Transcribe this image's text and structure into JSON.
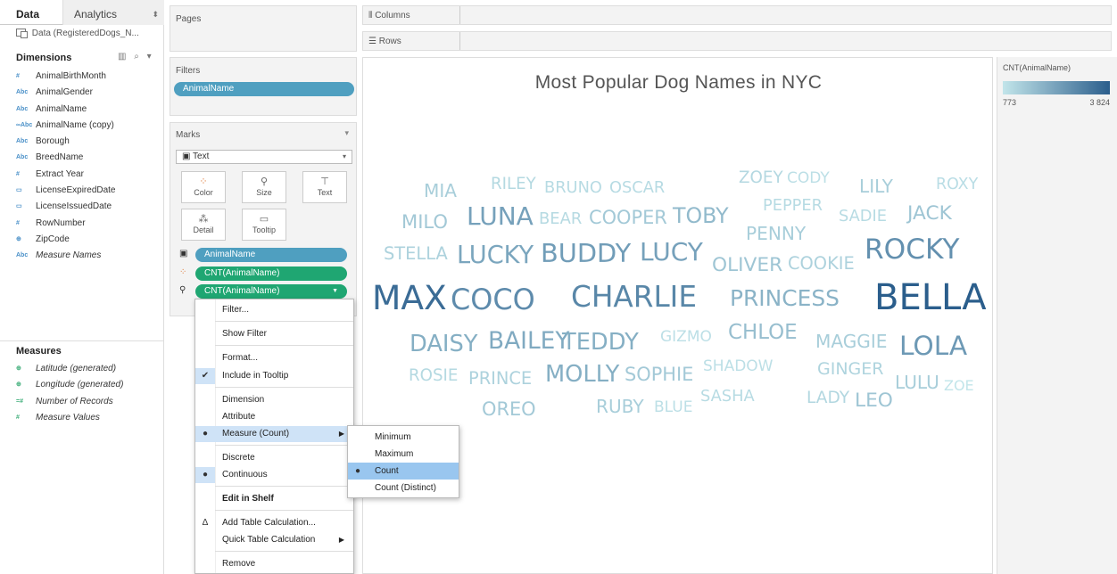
{
  "tabs": {
    "data": "Data",
    "analytics": "Analytics"
  },
  "datasource": "Data (RegisteredDogs_N...",
  "dimensions": {
    "header": "Dimensions",
    "tools": "▥ ⌕ ▾",
    "fields": [
      {
        "icon": "#",
        "label": "AnimalBirthMonth",
        "kind": "dim"
      },
      {
        "icon": "Abc",
        "label": "AnimalGender",
        "kind": "dim"
      },
      {
        "icon": "Abc",
        "label": "AnimalName",
        "kind": "dim"
      },
      {
        "icon": "∞Abc",
        "label": "AnimalName (copy)",
        "kind": "dim"
      },
      {
        "icon": "Abc",
        "label": "Borough",
        "kind": "dim"
      },
      {
        "icon": "Abc",
        "label": "BreedName",
        "kind": "dim"
      },
      {
        "icon": "#",
        "label": "Extract Year",
        "kind": "dim"
      },
      {
        "icon": "▭",
        "label": "LicenseExpiredDate",
        "kind": "dim"
      },
      {
        "icon": "▭",
        "label": "LicenseIssuedDate",
        "kind": "dim"
      },
      {
        "icon": "#",
        "label": "RowNumber",
        "kind": "dim"
      },
      {
        "icon": "⊕",
        "label": "ZipCode",
        "kind": "dim"
      },
      {
        "icon": "Abc",
        "label": "Measure Names",
        "kind": "dim",
        "italic": true
      }
    ]
  },
  "measures": {
    "header": "Measures",
    "fields": [
      {
        "icon": "⊕",
        "label": "Latitude (generated)",
        "kind": "mea",
        "italic": true
      },
      {
        "icon": "⊕",
        "label": "Longitude (generated)",
        "kind": "mea",
        "italic": true
      },
      {
        "icon": "=#",
        "label": "Number of Records",
        "kind": "mea",
        "italic": true
      },
      {
        "icon": "#",
        "label": "Measure Values",
        "kind": "mea",
        "italic": true
      }
    ]
  },
  "shelves": {
    "pages": "Pages",
    "filters": "Filters",
    "filter_pill": "AnimalName",
    "columns": "Columns",
    "rows": "Rows"
  },
  "marks": {
    "title": "Marks",
    "mark_type": "Text",
    "buttons": {
      "color": "Color",
      "size": "Size",
      "text": "Text",
      "detail": "Detail",
      "tooltip": "Tooltip"
    },
    "pills": [
      "AnimalName",
      "CNT(AnimalName)",
      "CNT(AnimalName)"
    ]
  },
  "chart_data": {
    "type": "word-cloud",
    "title": "Most Popular Dog Names in NYC",
    "measure": "CNT(AnimalName)",
    "value_range": [
      773,
      3824
    ],
    "words": [
      {
        "name": "MIA",
        "count": 1300
      },
      {
        "name": "RILEY",
        "count": 1050
      },
      {
        "name": "BRUNO",
        "count": 1000
      },
      {
        "name": "OSCAR",
        "count": 1000
      },
      {
        "name": "ZOEY",
        "count": 1060
      },
      {
        "name": "CODY",
        "count": 900
      },
      {
        "name": "LILY",
        "count": 1300
      },
      {
        "name": "ROXY",
        "count": 950
      },
      {
        "name": "MILO",
        "count": 1420
      },
      {
        "name": "LUNA",
        "count": 2300
      },
      {
        "name": "BEAR",
        "count": 1020
      },
      {
        "name": "COOPER",
        "count": 1400
      },
      {
        "name": "TOBY",
        "count": 1750
      },
      {
        "name": "PEPPER",
        "count": 1000
      },
      {
        "name": "SADIE",
        "count": 1000
      },
      {
        "name": "JACK",
        "count": 1500
      },
      {
        "name": "PENNY",
        "count": 1300
      },
      {
        "name": "STELLA",
        "count": 1200
      },
      {
        "name": "LUCKY",
        "count": 2200
      },
      {
        "name": "BUDDY",
        "count": 2400
      },
      {
        "name": "LUCY",
        "count": 2300
      },
      {
        "name": "OLIVER",
        "count": 1500
      },
      {
        "name": "COOKIE",
        "count": 1200
      },
      {
        "name": "ROCKY",
        "count": 2700
      },
      {
        "name": "MAX",
        "count": 3500
      },
      {
        "name": "COCO",
        "count": 2800
      },
      {
        "name": "CHARLIE",
        "count": 2900
      },
      {
        "name": "PRINCESS",
        "count": 1900
      },
      {
        "name": "BELLA",
        "count": 3824
      },
      {
        "name": "DAISY",
        "count": 2000
      },
      {
        "name": "BAILEY",
        "count": 2100
      },
      {
        "name": "TEDDY",
        "count": 2000
      },
      {
        "name": "GIZMO",
        "count": 900
      },
      {
        "name": "CHLOE",
        "count": 1650
      },
      {
        "name": "MAGGIE",
        "count": 1300
      },
      {
        "name": "LOLA",
        "count": 2500
      },
      {
        "name": "ROSIE",
        "count": 1050
      },
      {
        "name": "PRINCE",
        "count": 1200
      },
      {
        "name": "MOLLY",
        "count": 2000
      },
      {
        "name": "SOPHIE",
        "count": 1400
      },
      {
        "name": "SHADOW",
        "count": 900
      },
      {
        "name": "GINGER",
        "count": 1150
      },
      {
        "name": "LULU",
        "count": 1300
      },
      {
        "name": "ZOE",
        "count": 773
      },
      {
        "name": "OREO",
        "count": 1400
      },
      {
        "name": "RUBY",
        "count": 1300
      },
      {
        "name": "BLUE",
        "count": 900
      },
      {
        "name": "SASHA",
        "count": 1000
      },
      {
        "name": "LADY",
        "count": 1100
      },
      {
        "name": "LEO",
        "count": 1500
      }
    ]
  },
  "legend": {
    "title": "CNT(AnimalName)",
    "min": "773",
    "max": "3 824",
    "color_low": "#c2e5ea",
    "color_high": "#2b5e8c"
  },
  "context_menu": {
    "items": [
      {
        "label": "Filter...",
        "check": ""
      },
      {
        "label": "Show Filter",
        "check": ""
      },
      {
        "label": "Format...",
        "check": ""
      },
      {
        "label": "Include in Tooltip",
        "check": "✔"
      },
      {
        "label": "Dimension",
        "check": ""
      },
      {
        "label": "Attribute",
        "check": ""
      },
      {
        "label": "Measure (Count)",
        "check": "●",
        "arrow": "▶"
      },
      {
        "label": "Discrete",
        "check": ""
      },
      {
        "label": "Continuous",
        "check": "●"
      },
      {
        "label": "Edit in Shelf",
        "check": ""
      },
      {
        "label": "Add Table Calculation...",
        "check": "Δ"
      },
      {
        "label": "Quick Table Calculation",
        "check": "",
        "arrow": "▶"
      },
      {
        "label": "Remove",
        "check": ""
      }
    ]
  },
  "submenu": {
    "items": [
      {
        "label": "Minimum",
        "check": ""
      },
      {
        "label": "Maximum",
        "check": ""
      },
      {
        "label": "Count",
        "check": "●"
      },
      {
        "label": "Count (Distinct)",
        "check": ""
      }
    ]
  }
}
